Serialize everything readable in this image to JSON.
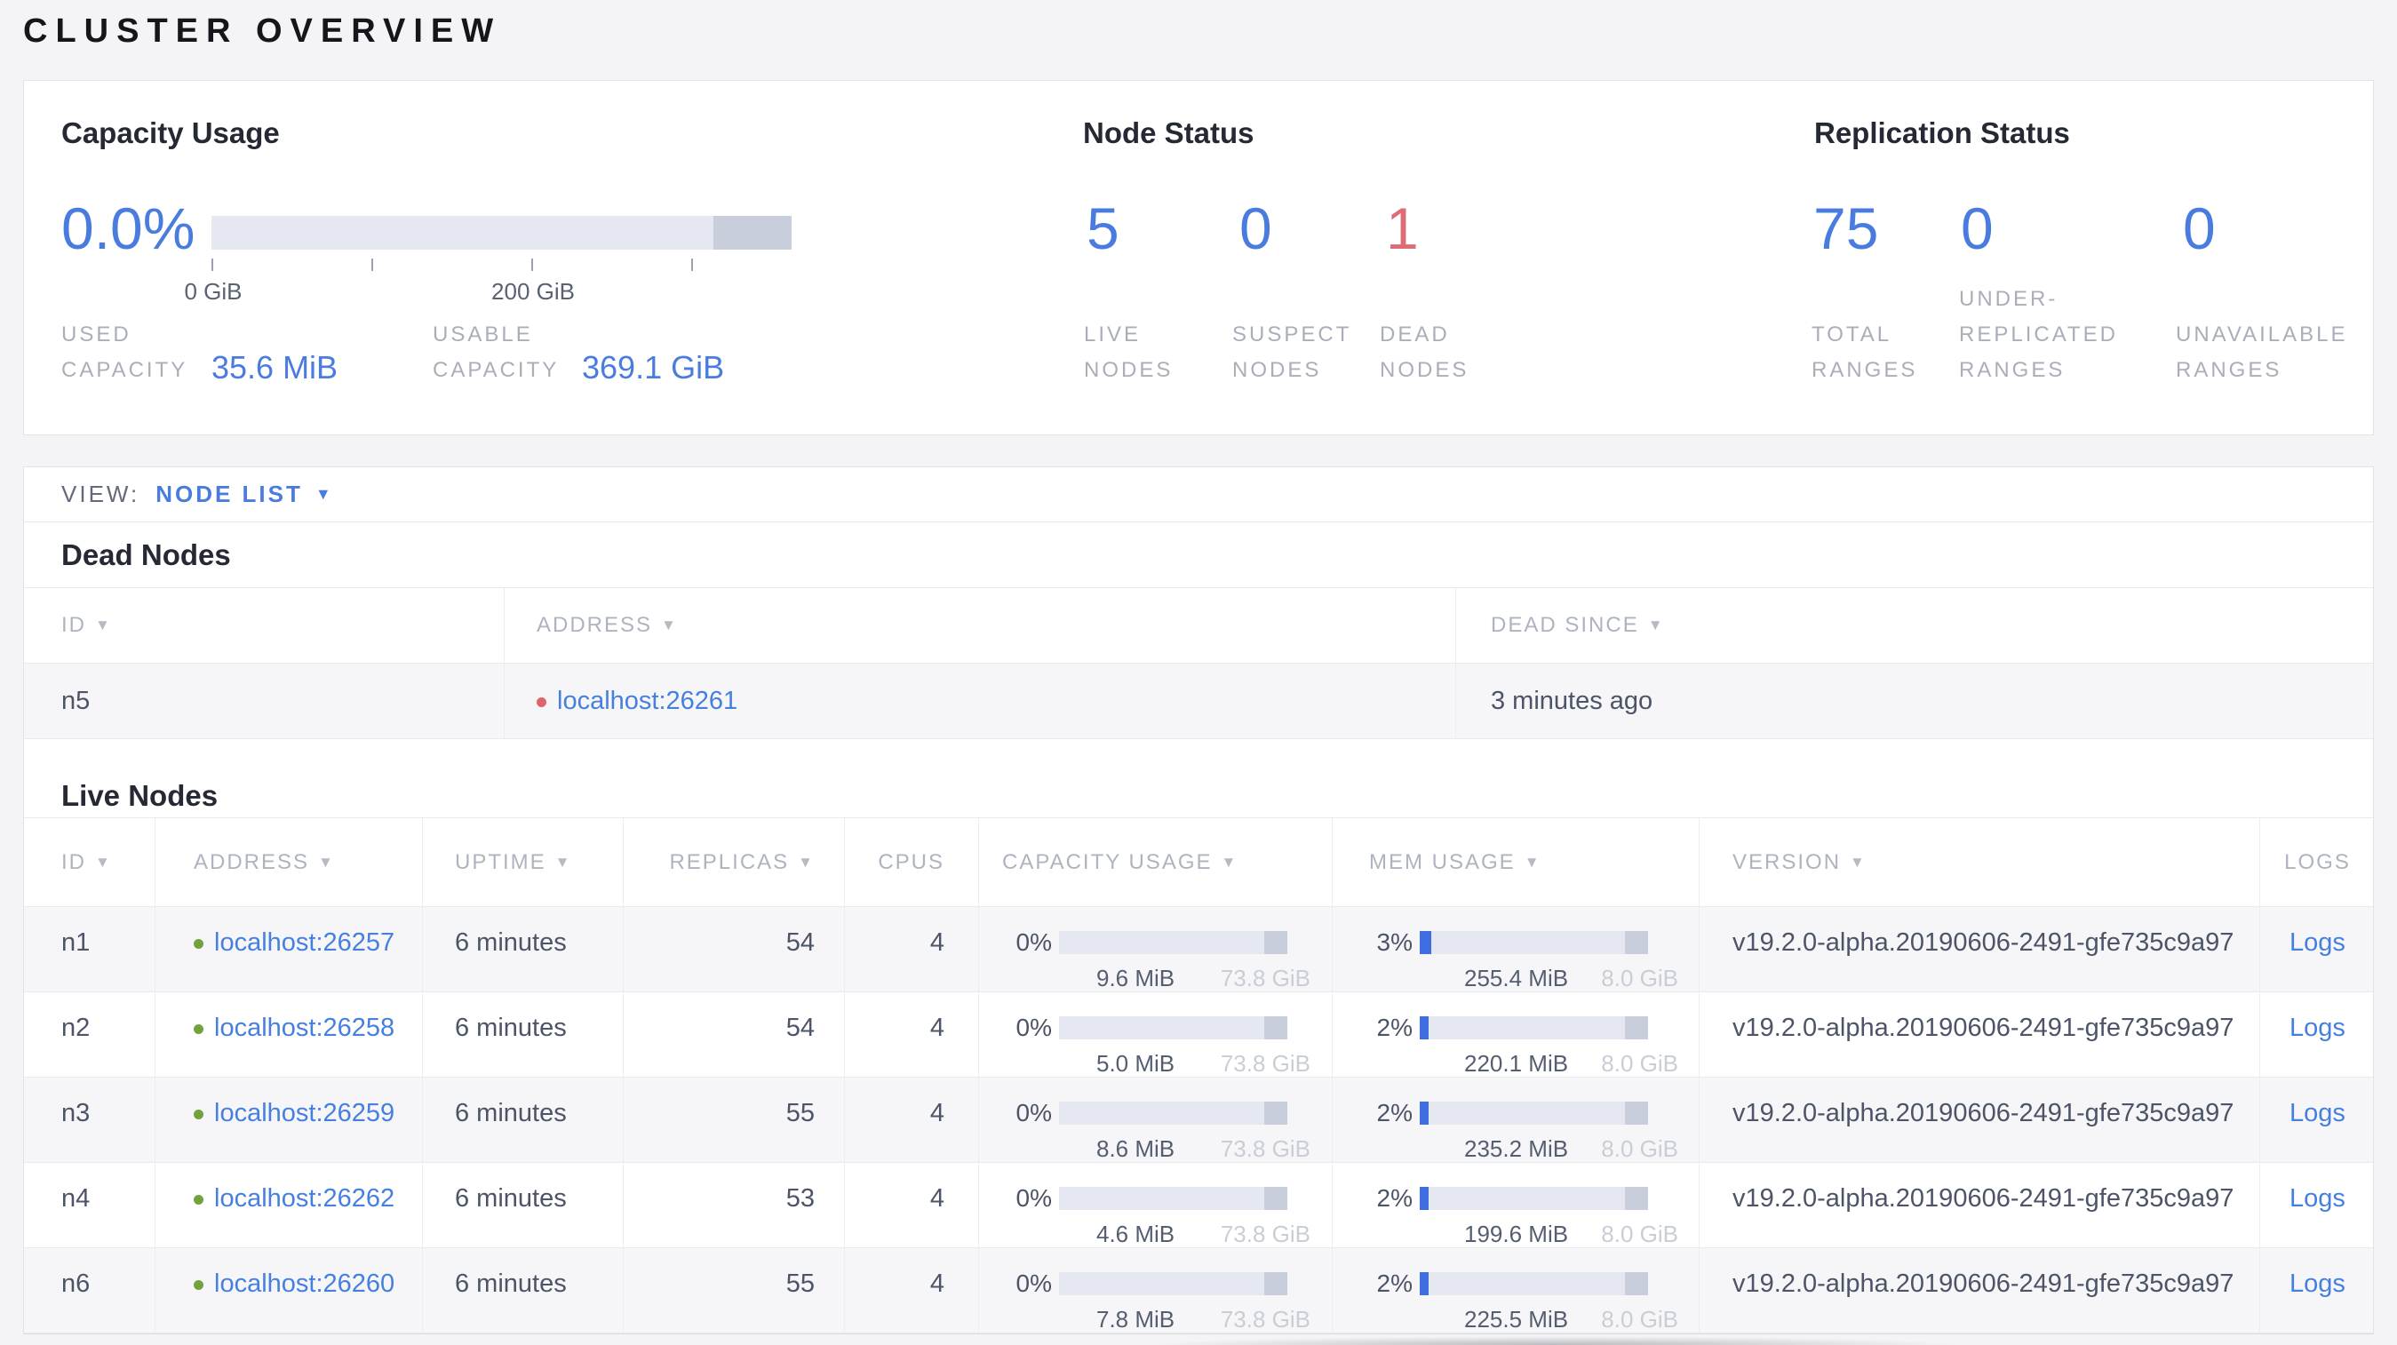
{
  "page": {
    "title": "CLUSTER OVERVIEW"
  },
  "capacity": {
    "title": "Capacity Usage",
    "percent": "0.0%",
    "tick_labels": [
      "0 GiB",
      "200 GiB"
    ],
    "used_label": "USED\nCAPACITY",
    "used_value": "35.6 MiB",
    "usable_label": "USABLE\nCAPACITY",
    "usable_value": "369.1 GiB"
  },
  "node_status": {
    "title": "Node Status",
    "stats": [
      {
        "value": "5",
        "label": "LIVE\nNODES",
        "state": "live"
      },
      {
        "value": "0",
        "label": "SUSPECT\nNODES",
        "state": "suspect"
      },
      {
        "value": "1",
        "label": "DEAD\nNODES",
        "state": "dead"
      }
    ]
  },
  "replication_status": {
    "title": "Replication Status",
    "stats": [
      {
        "value": "75",
        "label": "TOTAL\nRANGES"
      },
      {
        "value": "0",
        "label": "UNDER-\nREPLICATED\nRANGES"
      },
      {
        "value": "0",
        "label": "UNAVAILABLE\nRANGES"
      }
    ]
  },
  "view_bar": {
    "label": "VIEW:",
    "selected": "NODE LIST",
    "caret": "▼"
  },
  "dead_nodes": {
    "heading": "Dead Nodes",
    "columns": [
      {
        "label": "ID",
        "arrow": "▼"
      },
      {
        "label": "ADDRESS",
        "arrow": "▼"
      },
      {
        "label": "DEAD SINCE",
        "arrow": "▼"
      }
    ],
    "rows": [
      {
        "id": "n5",
        "address": "localhost:26261",
        "dead_since": "3 minutes ago"
      }
    ]
  },
  "live_nodes": {
    "heading": "Live Nodes",
    "logs_label": "Logs",
    "columns": [
      {
        "label": "ID",
        "arrow": "▼"
      },
      {
        "label": "ADDRESS",
        "arrow": "▼"
      },
      {
        "label": "UPTIME",
        "arrow": "▼"
      },
      {
        "label": "REPLICAS",
        "arrow": "▼"
      },
      {
        "label": "CPUS",
        "arrow": ""
      },
      {
        "label": "CAPACITY USAGE",
        "arrow": "▼"
      },
      {
        "label": "MEM USAGE",
        "arrow": "▼"
      },
      {
        "label": "VERSION",
        "arrow": "▼"
      },
      {
        "label": "LOGS",
        "arrow": ""
      }
    ],
    "rows": [
      {
        "id": "n1",
        "address": "localhost:26257",
        "uptime": "6 minutes",
        "replicas": "54",
        "cpus": "4",
        "cap_pct": "0%",
        "cap_used": "9.6 MiB",
        "cap_total": "73.8 GiB",
        "mem_pct": "3%",
        "mem_used": "255.4 MiB",
        "mem_total": "8.0 GiB",
        "version": "v19.2.0-alpha.20190606-2491-gfe735c9a97"
      },
      {
        "id": "n2",
        "address": "localhost:26258",
        "uptime": "6 minutes",
        "replicas": "54",
        "cpus": "4",
        "cap_pct": "0%",
        "cap_used": "5.0 MiB",
        "cap_total": "73.8 GiB",
        "mem_pct": "2%",
        "mem_used": "220.1 MiB",
        "mem_total": "8.0 GiB",
        "version": "v19.2.0-alpha.20190606-2491-gfe735c9a97"
      },
      {
        "id": "n3",
        "address": "localhost:26259",
        "uptime": "6 minutes",
        "replicas": "55",
        "cpus": "4",
        "cap_pct": "0%",
        "cap_used": "8.6 MiB",
        "cap_total": "73.8 GiB",
        "mem_pct": "2%",
        "mem_used": "235.2 MiB",
        "mem_total": "8.0 GiB",
        "version": "v19.2.0-alpha.20190606-2491-gfe735c9a97"
      },
      {
        "id": "n4",
        "address": "localhost:26262",
        "uptime": "6 minutes",
        "replicas": "53",
        "cpus": "4",
        "cap_pct": "0%",
        "cap_used": "4.6 MiB",
        "cap_total": "73.8 GiB",
        "mem_pct": "2%",
        "mem_used": "199.6 MiB",
        "mem_total": "8.0 GiB",
        "version": "v19.2.0-alpha.20190606-2491-gfe735c9a97"
      },
      {
        "id": "n6",
        "address": "localhost:26260",
        "uptime": "6 minutes",
        "replicas": "55",
        "cpus": "4",
        "cap_pct": "0%",
        "cap_used": "7.8 MiB",
        "cap_total": "73.8 GiB",
        "mem_pct": "2%",
        "mem_used": "225.5 MiB",
        "mem_total": "8.0 GiB",
        "version": "v19.2.0-alpha.20190606-2491-gfe735c9a97"
      }
    ]
  },
  "colors": {
    "accent_blue": "#4a7ce0",
    "dead_red": "#de6c74",
    "live_green": "#72a23e",
    "bar_track": "#e5e8f0",
    "bar_reserved": "#c8cedb"
  }
}
